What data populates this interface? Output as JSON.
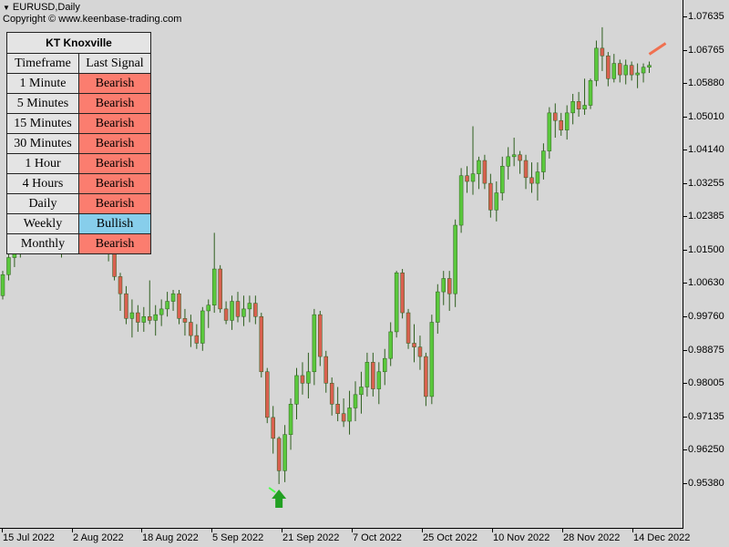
{
  "header": {
    "symbol_title": "EURUSD,Daily",
    "copyright": "Copyright © www.keenbase-trading.com"
  },
  "indicator": {
    "name": "KT Knoxville",
    "columns": [
      "Timeframe",
      "Last Signal"
    ],
    "rows": [
      {
        "timeframe": "1 Minute",
        "signal": "Bearish"
      },
      {
        "timeframe": "5 Minutes",
        "signal": "Bearish"
      },
      {
        "timeframe": "15 Minutes",
        "signal": "Bearish"
      },
      {
        "timeframe": "30 Minutes",
        "signal": "Bearish"
      },
      {
        "timeframe": "1 Hour",
        "signal": "Bearish"
      },
      {
        "timeframe": "4 Hours",
        "signal": "Bearish"
      },
      {
        "timeframe": "Daily",
        "signal": "Bearish"
      },
      {
        "timeframe": "Weekly",
        "signal": "Bullish"
      },
      {
        "timeframe": "Monthly",
        "signal": "Bearish"
      }
    ],
    "colors": {
      "bearish": "#fb7d6f",
      "bullish": "#87ceeb"
    }
  },
  "colors": {
    "background": "#d6d6d6",
    "bull_candle": "#5ac83c",
    "bear_candle": "#d9604f",
    "wick": "#2e5e1e",
    "buy_arrow": "#22a022",
    "sell_marker": "#f07050"
  },
  "price_axis": [
    "1.07635",
    "1.06765",
    "1.05880",
    "1.05010",
    "1.04140",
    "1.03255",
    "1.02385",
    "1.01500",
    "1.00630",
    "0.99760",
    "0.98875",
    "0.98005",
    "0.97135",
    "0.96250",
    "0.95380"
  ],
  "time_axis": [
    "15 Jul 2022",
    "2 Aug 2022",
    "18 Aug 2022",
    "5 Sep 2022",
    "21 Sep 2022",
    "7 Oct 2022",
    "25 Oct 2022",
    "10 Nov 2022",
    "28 Nov 2022",
    "14 Dec 2022"
  ],
  "chart_data": {
    "type": "candlestick",
    "symbol": "EURUSD",
    "timeframe": "Daily",
    "ylim": [
      0.952,
      1.078
    ],
    "candles": [
      {
        "o": 1.003,
        "h": 1.0095,
        "l": 1.002,
        "c": 1.0085
      },
      {
        "o": 1.0085,
        "h": 1.015,
        "l": 1.007,
        "c": 1.013
      },
      {
        "o": 1.013,
        "h": 1.0175,
        "l": 1.0105,
        "c": 1.016
      },
      {
        "o": 1.016,
        "h": 1.0195,
        "l": 1.013,
        "c": 1.0175
      },
      {
        "o": 1.0175,
        "h": 1.021,
        "l": 1.0145,
        "c": 1.019
      },
      {
        "o": 1.019,
        "h": 1.0215,
        "l": 1.016,
        "c": 1.017
      },
      {
        "o": 1.017,
        "h": 1.02,
        "l": 1.014,
        "c": 1.0185
      },
      {
        "o": 1.0185,
        "h": 1.0225,
        "l": 1.0165,
        "c": 1.0205
      },
      {
        "o": 1.0205,
        "h": 1.0235,
        "l": 1.018,
        "c": 1.0195
      },
      {
        "o": 1.0195,
        "h": 1.0215,
        "l": 1.015,
        "c": 1.0165
      },
      {
        "o": 1.0165,
        "h": 1.0195,
        "l": 1.013,
        "c": 1.018
      },
      {
        "o": 1.018,
        "h": 1.021,
        "l": 1.0155,
        "c": 1.02
      },
      {
        "o": 1.02,
        "h": 1.024,
        "l": 1.018,
        "c": 1.0215
      },
      {
        "o": 1.0215,
        "h": 1.0245,
        "l": 1.019,
        "c": 1.02
      },
      {
        "o": 1.02,
        "h": 1.0225,
        "l": 1.0165,
        "c": 1.0185
      },
      {
        "o": 1.0185,
        "h": 1.021,
        "l": 1.015,
        "c": 1.0195
      },
      {
        "o": 1.0195,
        "h": 1.023,
        "l": 1.017,
        "c": 1.021
      },
      {
        "o": 1.021,
        "h": 1.024,
        "l": 1.0185,
        "c": 1.0195
      },
      {
        "o": 1.0195,
        "h": 1.0215,
        "l": 1.012,
        "c": 1.014
      },
      {
        "o": 1.014,
        "h": 1.016,
        "l": 1.007,
        "c": 1.008
      },
      {
        "o": 1.008,
        "h": 1.009,
        "l": 0.999,
        "c": 1.0035
      },
      {
        "o": 1.0035,
        "h": 1.0055,
        "l": 0.9955,
        "c": 0.997
      },
      {
        "o": 0.997,
        "h": 1.002,
        "l": 0.992,
        "c": 0.9985
      },
      {
        "o": 0.9985,
        "h": 1.0005,
        "l": 0.9935,
        "c": 0.996
      },
      {
        "o": 0.996,
        "h": 1.0,
        "l": 0.9935,
        "c": 0.9975
      },
      {
        "o": 0.9975,
        "h": 1.007,
        "l": 0.9955,
        "c": 0.9965
      },
      {
        "o": 0.9965,
        "h": 1.0005,
        "l": 0.9925,
        "c": 0.998
      },
      {
        "o": 0.998,
        "h": 1.002,
        "l": 0.995,
        "c": 0.9995
      },
      {
        "o": 0.9995,
        "h": 1.004,
        "l": 0.9975,
        "c": 1.0015
      },
      {
        "o": 1.0015,
        "h": 1.0045,
        "l": 0.999,
        "c": 1.0035
      },
      {
        "o": 1.0035,
        "h": 1.0045,
        "l": 0.9955,
        "c": 0.997
      },
      {
        "o": 0.997,
        "h": 0.9995,
        "l": 0.9925,
        "c": 0.996
      },
      {
        "o": 0.996,
        "h": 0.998,
        "l": 0.9895,
        "c": 0.9925
      },
      {
        "o": 0.9925,
        "h": 0.9955,
        "l": 0.989,
        "c": 0.9905
      },
      {
        "o": 0.9905,
        "h": 1.0,
        "l": 0.9885,
        "c": 0.999
      },
      {
        "o": 0.999,
        "h": 1.002,
        "l": 0.9945,
        "c": 1.0005
      },
      {
        "o": 1.0005,
        "h": 1.0195,
        "l": 0.9985,
        "c": 1.01
      },
      {
        "o": 1.01,
        "h": 1.011,
        "l": 0.9985,
        "c": 0.9995
      },
      {
        "o": 0.9995,
        "h": 1.0015,
        "l": 0.9955,
        "c": 0.9965
      },
      {
        "o": 0.9965,
        "h": 1.003,
        "l": 0.994,
        "c": 1.0015
      },
      {
        "o": 1.0015,
        "h": 1.004,
        "l": 0.996,
        "c": 0.9975
      },
      {
        "o": 0.9975,
        "h": 1.003,
        "l": 0.995,
        "c": 0.9995
      },
      {
        "o": 0.9995,
        "h": 1.003,
        "l": 0.996,
        "c": 1.001
      },
      {
        "o": 1.001,
        "h": 1.003,
        "l": 0.9955,
        "c": 0.9975
      },
      {
        "o": 0.9975,
        "h": 0.9985,
        "l": 0.9815,
        "c": 0.983
      },
      {
        "o": 0.983,
        "h": 0.984,
        "l": 0.9695,
        "c": 0.971
      },
      {
        "o": 0.971,
        "h": 0.974,
        "l": 0.9615,
        "c": 0.9655
      },
      {
        "o": 0.9655,
        "h": 0.966,
        "l": 0.9535,
        "c": 0.957
      },
      {
        "o": 0.957,
        "h": 0.969,
        "l": 0.954,
        "c": 0.9665
      },
      {
        "o": 0.9665,
        "h": 0.976,
        "l": 0.9625,
        "c": 0.9745
      },
      {
        "o": 0.9745,
        "h": 0.984,
        "l": 0.9705,
        "c": 0.982
      },
      {
        "o": 0.982,
        "h": 0.9855,
        "l": 0.977,
        "c": 0.98
      },
      {
        "o": 0.98,
        "h": 0.988,
        "l": 0.976,
        "c": 0.983
      },
      {
        "o": 0.983,
        "h": 0.9995,
        "l": 0.9795,
        "c": 0.998
      },
      {
        "o": 0.998,
        "h": 0.999,
        "l": 0.9845,
        "c": 0.987
      },
      {
        "o": 0.987,
        "h": 0.9885,
        "l": 0.9775,
        "c": 0.98
      },
      {
        "o": 0.98,
        "h": 0.9815,
        "l": 0.9715,
        "c": 0.9745
      },
      {
        "o": 0.9745,
        "h": 0.979,
        "l": 0.97,
        "c": 0.972
      },
      {
        "o": 0.972,
        "h": 0.976,
        "l": 0.9685,
        "c": 0.97
      },
      {
        "o": 0.97,
        "h": 0.978,
        "l": 0.9665,
        "c": 0.9735
      },
      {
        "o": 0.9735,
        "h": 0.9805,
        "l": 0.97,
        "c": 0.977
      },
      {
        "o": 0.977,
        "h": 0.983,
        "l": 0.972,
        "c": 0.979
      },
      {
        "o": 0.979,
        "h": 0.988,
        "l": 0.9765,
        "c": 0.9855
      },
      {
        "o": 0.9855,
        "h": 0.988,
        "l": 0.9765,
        "c": 0.9785
      },
      {
        "o": 0.9785,
        "h": 0.9855,
        "l": 0.9745,
        "c": 0.983
      },
      {
        "o": 0.983,
        "h": 0.989,
        "l": 0.9795,
        "c": 0.9865
      },
      {
        "o": 0.9865,
        "h": 0.996,
        "l": 0.9845,
        "c": 0.9935
      },
      {
        "o": 0.9935,
        "h": 1.0095,
        "l": 0.992,
        "c": 1.009
      },
      {
        "o": 1.009,
        "h": 1.01,
        "l": 0.997,
        "c": 0.9985
      },
      {
        "o": 0.9985,
        "h": 0.9995,
        "l": 0.989,
        "c": 0.9905
      },
      {
        "o": 0.9905,
        "h": 0.9955,
        "l": 0.9855,
        "c": 0.9895
      },
      {
        "o": 0.9895,
        "h": 0.9925,
        "l": 0.9835,
        "c": 0.987
      },
      {
        "o": 0.987,
        "h": 0.988,
        "l": 0.974,
        "c": 0.9765
      },
      {
        "o": 0.9765,
        "h": 0.998,
        "l": 0.9745,
        "c": 0.996
      },
      {
        "o": 0.996,
        "h": 1.006,
        "l": 0.993,
        "c": 1.004
      },
      {
        "o": 1.004,
        "h": 1.0095,
        "l": 1.0005,
        "c": 1.0075
      },
      {
        "o": 1.0075,
        "h": 1.0095,
        "l": 0.999,
        "c": 1.0035
      },
      {
        "o": 1.0035,
        "h": 1.023,
        "l": 1.0,
        "c": 1.0215
      },
      {
        "o": 1.0215,
        "h": 1.0365,
        "l": 1.0195,
        "c": 1.0345
      },
      {
        "o": 1.0345,
        "h": 1.037,
        "l": 1.03,
        "c": 1.033
      },
      {
        "o": 1.033,
        "h": 1.0475,
        "l": 1.0295,
        "c": 1.035
      },
      {
        "o": 1.035,
        "h": 1.0395,
        "l": 1.031,
        "c": 1.0385
      },
      {
        "o": 1.0385,
        "h": 1.04,
        "l": 1.031,
        "c": 1.0325
      },
      {
        "o": 1.0325,
        "h": 1.035,
        "l": 1.0235,
        "c": 1.0255
      },
      {
        "o": 1.0255,
        "h": 1.033,
        "l": 1.0225,
        "c": 1.03
      },
      {
        "o": 1.03,
        "h": 1.0395,
        "l": 1.028,
        "c": 1.037
      },
      {
        "o": 1.037,
        "h": 1.042,
        "l": 1.0335,
        "c": 1.0395
      },
      {
        "o": 1.0395,
        "h": 1.0445,
        "l": 1.037,
        "c": 1.04
      },
      {
        "o": 1.04,
        "h": 1.041,
        "l": 1.035,
        "c": 1.0385
      },
      {
        "o": 1.0385,
        "h": 1.04,
        "l": 1.031,
        "c": 1.034
      },
      {
        "o": 1.034,
        "h": 1.038,
        "l": 1.03,
        "c": 1.0325
      },
      {
        "o": 1.0325,
        "h": 1.038,
        "l": 1.028,
        "c": 1.0355
      },
      {
        "o": 1.0355,
        "h": 1.043,
        "l": 1.0335,
        "c": 1.041
      },
      {
        "o": 1.041,
        "h": 1.0525,
        "l": 1.039,
        "c": 1.051
      },
      {
        "o": 1.051,
        "h": 1.0535,
        "l": 1.0445,
        "c": 1.049
      },
      {
        "o": 1.049,
        "h": 1.051,
        "l": 1.045,
        "c": 1.0465
      },
      {
        "o": 1.0465,
        "h": 1.053,
        "l": 1.044,
        "c": 1.051
      },
      {
        "o": 1.051,
        "h": 1.056,
        "l": 1.048,
        "c": 1.054
      },
      {
        "o": 1.054,
        "h": 1.0565,
        "l": 1.05,
        "c": 1.052
      },
      {
        "o": 1.052,
        "h": 1.06,
        "l": 1.0505,
        "c": 1.053
      },
      {
        "o": 1.053,
        "h": 1.06,
        "l": 1.052,
        "c": 1.0595
      },
      {
        "o": 1.0595,
        "h": 1.07,
        "l": 1.058,
        "c": 1.068
      },
      {
        "o": 1.068,
        "h": 1.0735,
        "l": 1.062,
        "c": 1.066
      },
      {
        "o": 1.066,
        "h": 1.067,
        "l": 1.058,
        "c": 1.06
      },
      {
        "o": 1.06,
        "h": 1.0665,
        "l": 1.059,
        "c": 1.064
      },
      {
        "o": 1.064,
        "h": 1.065,
        "l": 1.059,
        "c": 1.061
      },
      {
        "o": 1.061,
        "h": 1.065,
        "l": 1.0585,
        "c": 1.0635
      },
      {
        "o": 1.0635,
        "h": 1.0645,
        "l": 1.0595,
        "c": 1.061
      },
      {
        "o": 1.061,
        "h": 1.064,
        "l": 1.0575,
        "c": 1.0615
      },
      {
        "o": 1.0615,
        "h": 1.064,
        "l": 1.059,
        "c": 1.063
      },
      {
        "o": 1.063,
        "h": 1.0645,
        "l": 1.0615,
        "c": 1.0635
      }
    ],
    "buy_signal_index": 47,
    "sell_signal_index": 110
  }
}
